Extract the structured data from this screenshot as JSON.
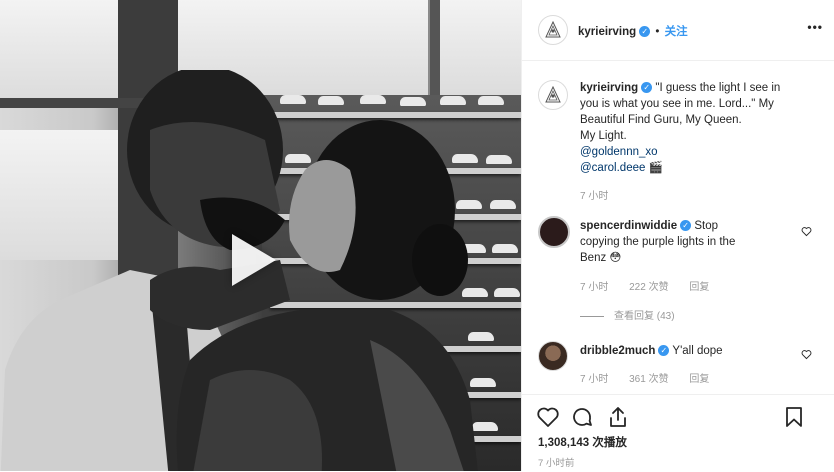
{
  "post": {
    "username": "kyrieirving",
    "follow_label": "关注",
    "more_label": "•••",
    "caption_lines": [
      "\"I guess the light I see in",
      "you is what you see in me. Lord...\" My",
      "Beautiful Find Guru, My Queen.",
      "My Light."
    ],
    "mentions": [
      "@goldennn_xo",
      "@carol.deee"
    ],
    "mention_emoji": "🎬",
    "caption_time": "7 小时"
  },
  "comments": [
    {
      "username": "spencerdinwiddie",
      "text_lines": [
        "Stop",
        "copying the purple lights in the",
        "Benz 😳"
      ],
      "time": "7 小时",
      "likes": "222 次赞",
      "reply": "回复",
      "view_replies": "查看回复 (43)"
    },
    {
      "username": "dribble2much",
      "text": "Y'all dope",
      "time": "7 小时",
      "likes": "361 次赞",
      "reply": "回复"
    }
  ],
  "stats": {
    "views": "1,308,143 次播放",
    "time": "7 小时前"
  },
  "colors": {
    "verified": "#3897f0",
    "link": "#00376b",
    "muted": "#999999"
  },
  "icons": [
    "heart-icon",
    "comment-icon",
    "share-icon",
    "bookmark-icon",
    "play-icon",
    "verified-icon"
  ]
}
